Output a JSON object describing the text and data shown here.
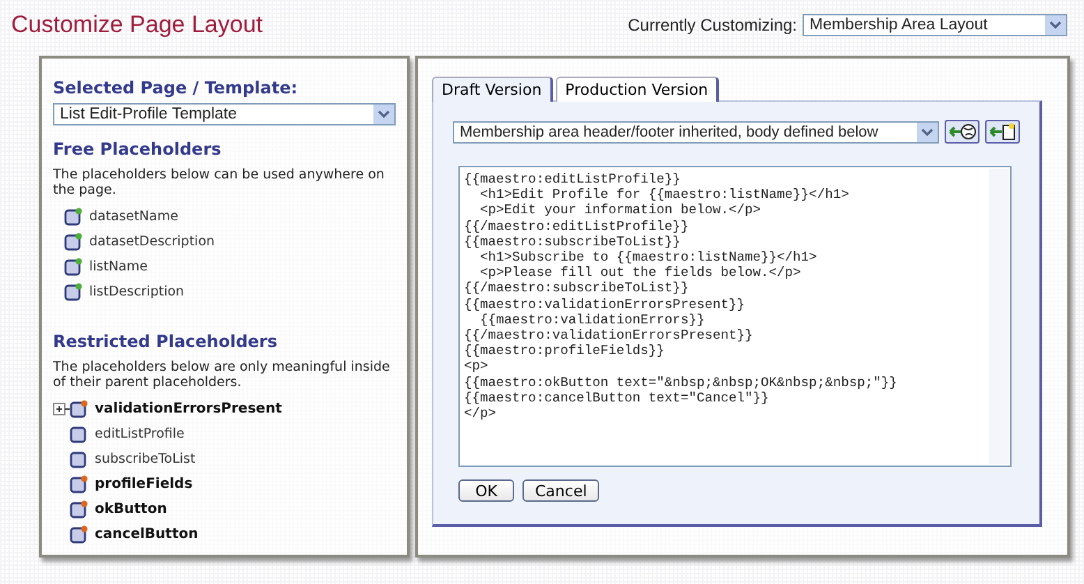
{
  "page": {
    "title": "Customize Page Layout",
    "customizing_label": "Currently Customizing:",
    "customizing_value": "Membership Area Layout"
  },
  "template_panel": {
    "heading": "Selected Page / Template:",
    "template_value": "List Edit-Profile Template",
    "sections": [
      {
        "heading": "Free Placeholders",
        "description": "The placeholders below can be used anywhere on the page.",
        "items": [
          {
            "label": "datasetName",
            "bold": false,
            "color": "#4caf3a",
            "expandable": false
          },
          {
            "label": "datasetDescription",
            "bold": false,
            "color": "#4caf3a",
            "expandable": false
          },
          {
            "label": "listName",
            "bold": false,
            "color": "#4caf3a",
            "expandable": false
          },
          {
            "label": "listDescription",
            "bold": false,
            "color": "#4caf3a",
            "expandable": false
          }
        ]
      },
      {
        "heading": "Restricted Placeholders",
        "description": "The placeholders below are only meaningful inside of their parent placeholders.",
        "items": [
          {
            "label": "validationErrorsPresent",
            "bold": true,
            "color": "#e0661e",
            "expandable": true
          },
          {
            "label": "editListProfile",
            "bold": false,
            "expandable": false
          },
          {
            "label": "subscribeToList",
            "bold": false,
            "expandable": false
          },
          {
            "label": "profileFields",
            "bold": true,
            "color": "#e0661e",
            "expandable": false
          },
          {
            "label": "okButton",
            "bold": true,
            "color": "#e0661e",
            "expandable": false
          },
          {
            "label": "cancelButton",
            "bold": true,
            "color": "#e0661e",
            "expandable": false
          }
        ]
      }
    ]
  },
  "editor_panel": {
    "tabs": [
      {
        "label": "Draft Version",
        "selected": true
      },
      {
        "label": "Production Version",
        "selected": false
      }
    ],
    "layout_value": "Membership area header/footer inherited, body defined below",
    "code_lines": [
      "{{maestro:editListProfile}}",
      "  <h1>Edit Profile for {{maestro:listName}}</h1>",
      "  <p>Edit your information below.</p>",
      "{{/maestro:editListProfile}}",
      "{{maestro:subscribeToList}}",
      "  <h1>Subscribe to {{maestro:listName}}</h1>",
      "  <p>Please fill out the fields below.</p>",
      "{{/maestro:subscribeToList}}",
      "{{maestro:validationErrorsPresent}}",
      "  {{maestro:validationErrors}}",
      "{{/maestro:validationErrorsPresent}}",
      "{{maestro:profileFields}}",
      "<p>",
      "{{maestro:okButton text=\"&nbsp;&nbsp;OK&nbsp;&nbsp;\"}}",
      "{{maestro:cancelButton text=\"Cancel\"}}",
      "</p>"
    ],
    "buttons": [
      "OK",
      "Cancel"
    ]
  }
}
